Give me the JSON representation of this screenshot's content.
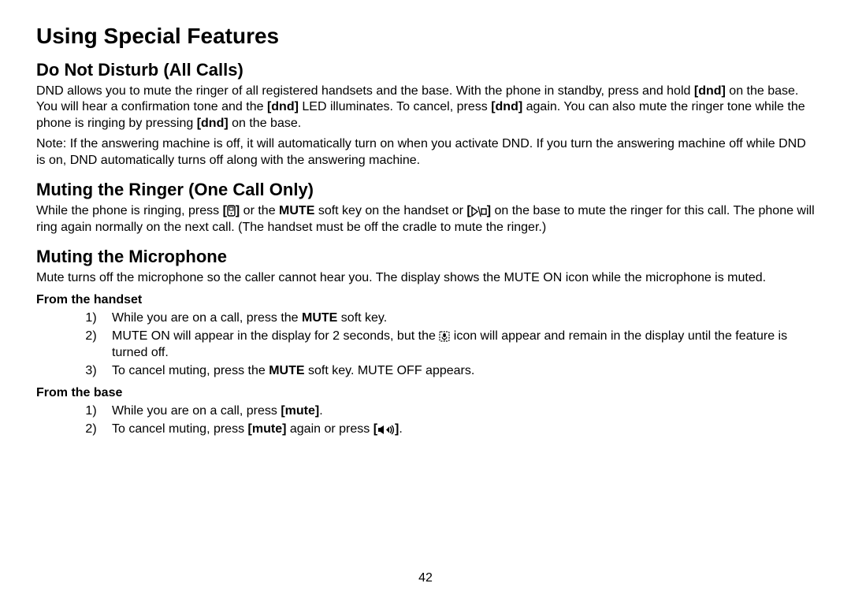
{
  "page_number": "42",
  "title": "Using Special Features",
  "sections": {
    "dnd": {
      "heading": "Do Not Disturb (All Calls)",
      "para1_prefix": "DND allows you to mute the ringer of all registered handsets and the base. With the phone in standby, press and hold ",
      "dnd1": "[dnd]",
      "para1_mid1": " on the base. You will hear a confirmation tone and the ",
      "dnd2": "[dnd]",
      "para1_mid2": " LED illuminates. To cancel, press ",
      "dnd3": "[dnd]",
      "para1_mid3": " again. You can also mute the ringer tone while the phone is ringing by pressing ",
      "dnd4": "[dnd]",
      "para1_end": " on the base.",
      "para2": "Note: If the answering machine is off, it will automatically turn on when you activate DND. If you turn the answering machine off while DND is on, DND automatically turns off along with the answering machine."
    },
    "ringer": {
      "heading": "Muting the Ringer (One Call Only)",
      "p1_a": "While the phone is ringing, press ",
      "p1_b": " or the ",
      "mute_label": "MUTE",
      "p1_c": " soft key on the handset or ",
      "p1_d": " on the base to mute the ringer for this call. The phone will ring again normally on the next call. (The handset must be off the cradle to mute the ringer.)"
    },
    "mic": {
      "heading": "Muting the Microphone",
      "intro": "Mute turns off the microphone so the caller cannot hear you. The display shows the MUTE ON icon while the microphone is muted.",
      "handset_heading": "From the handset",
      "handset_items": {
        "i1_a": "While you are on a call, press the ",
        "i1_mute": "MUTE",
        "i1_b": " soft key.",
        "i2_a": "MUTE ON will appear in the display for 2 seconds, but the ",
        "i2_b": " icon will appear and remain in the display until the feature is turned off.",
        "i3_a": "To cancel muting, press the ",
        "i3_mute": "MUTE",
        "i3_b": " soft key. MUTE OFF appears."
      },
      "base_heading": "From the base",
      "base_items": {
        "i1_a": "While you are on a call, press ",
        "i1_mute": "[mute]",
        "i1_b": ".",
        "i2_a": "To cancel muting, press ",
        "i2_mute": "[mute]",
        "i2_b": " again or press ",
        "i2_c": "."
      }
    }
  }
}
